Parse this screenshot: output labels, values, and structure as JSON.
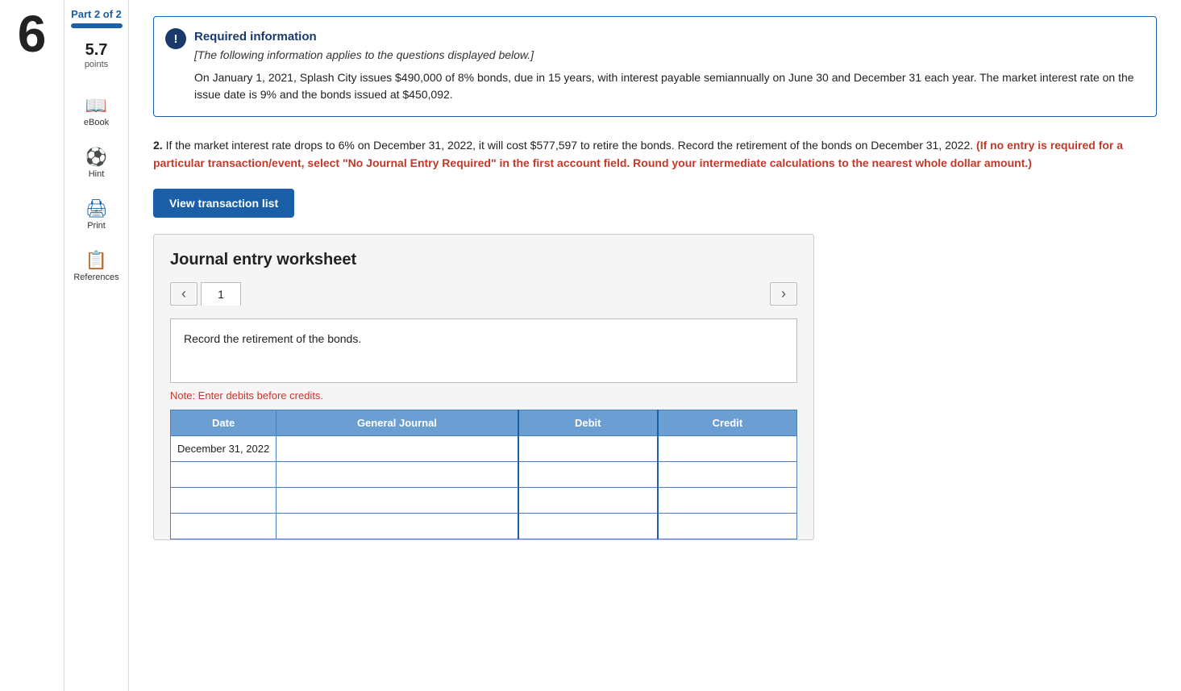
{
  "left": {
    "question_number": "6"
  },
  "sidebar": {
    "part_label": "Part 2 of 2",
    "progress_percent": 100,
    "points_number": "5.7",
    "points_label": "points",
    "items": [
      {
        "id": "ebook",
        "label": "eBook",
        "icon": "📖"
      },
      {
        "id": "hint",
        "label": "Hint",
        "icon": "⚽"
      },
      {
        "id": "print",
        "label": "Print",
        "icon": "🖨"
      },
      {
        "id": "references",
        "label": "References",
        "icon": "📋"
      }
    ]
  },
  "info_box": {
    "icon": "!",
    "title": "Required information",
    "italic_text": "[The following information applies to the questions displayed below.]",
    "body": "On January 1, 2021, Splash City issues $490,000 of 8% bonds, due in 15 years, with interest payable semiannually on June 30 and December 31 each year. The market interest rate on the issue date is 9% and the bonds issued at $450,092."
  },
  "question": {
    "number": "2.",
    "text_before_bold": "If the market interest rate drops to 6% on December 31, 2022, it will cost $577,597 to retire the bonds. Record the retirement of the bonds on December 31, 2022. ",
    "bold_red_text": "(If no entry is required for a particular transaction/event, select \"No Journal Entry Required\" in the first account field. Round your intermediate calculations to the nearest whole dollar amount.)"
  },
  "buttons": {
    "view_transaction_list": "View transaction list"
  },
  "worksheet": {
    "title": "Journal entry worksheet",
    "page_number": "1",
    "description": "Record the retirement of the bonds.",
    "note": "Note: Enter debits before credits.",
    "table": {
      "headers": [
        "Date",
        "General Journal",
        "Debit",
        "Credit"
      ],
      "rows": [
        {
          "date": "December 31, 2022",
          "journal": "",
          "debit": "",
          "credit": ""
        },
        {
          "date": "",
          "journal": "",
          "debit": "",
          "credit": ""
        },
        {
          "date": "",
          "journal": "",
          "debit": "",
          "credit": ""
        },
        {
          "date": "",
          "journal": "",
          "debit": "",
          "credit": ""
        }
      ]
    }
  }
}
